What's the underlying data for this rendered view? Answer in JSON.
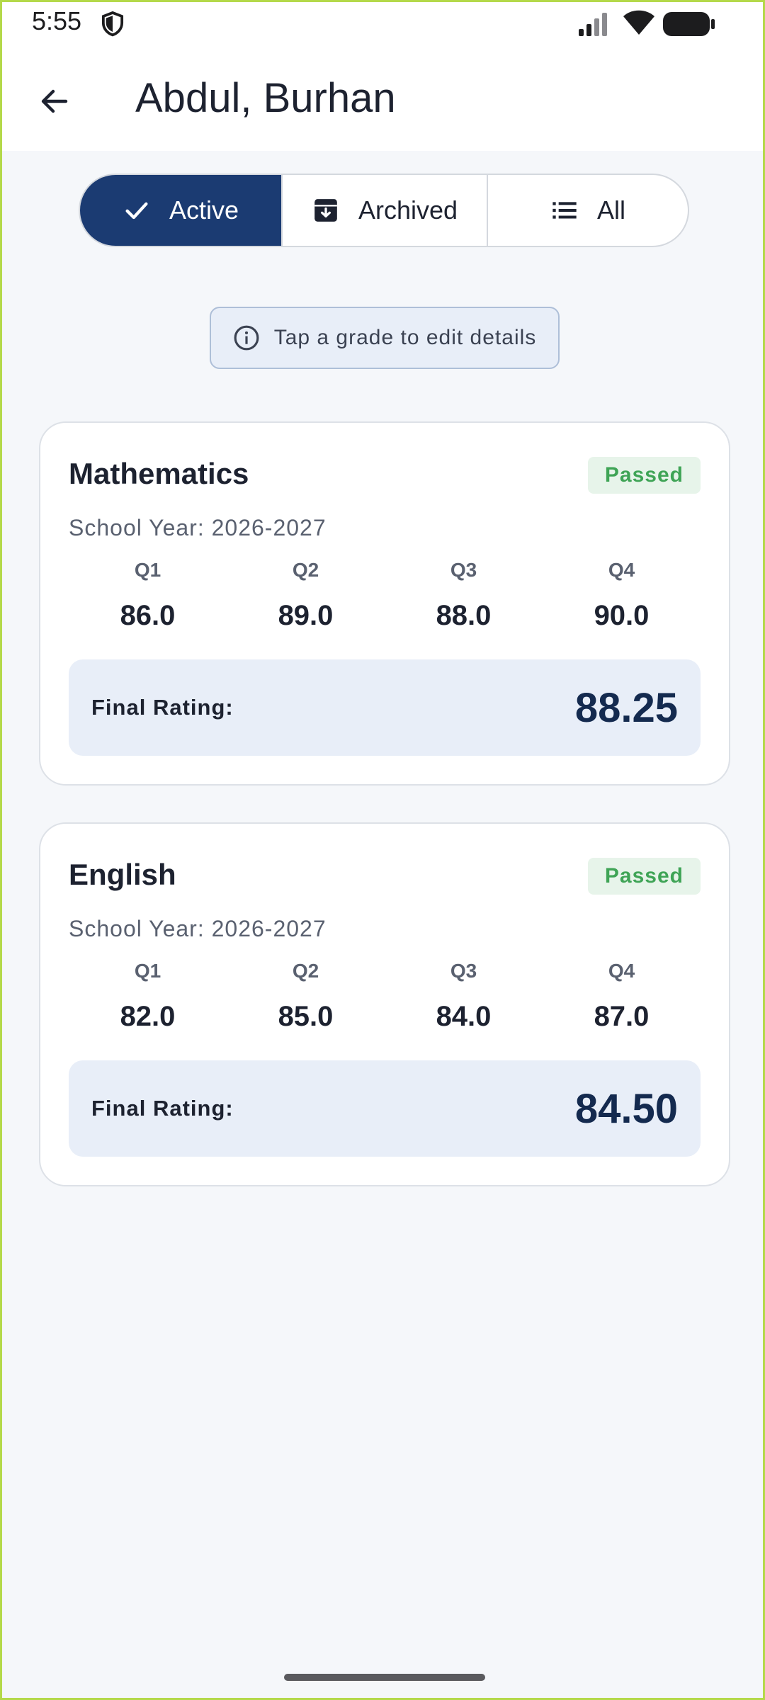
{
  "status_bar": {
    "time": "5:55",
    "icons": [
      "shield-icon",
      "signal-icon",
      "wifi-icon",
      "battery-icon"
    ]
  },
  "app_bar": {
    "title": "Abdul, Burhan",
    "back_icon": "arrow-left-icon"
  },
  "filter": {
    "selected": "Active",
    "segments": [
      {
        "label": "Active",
        "icon": "check-icon"
      },
      {
        "label": "Archived",
        "icon": "archive-box-icon"
      },
      {
        "label": "All",
        "icon": "list-icon"
      }
    ]
  },
  "hint": {
    "text": "Tap a grade to edit details",
    "icon": "info-icon"
  },
  "grades": [
    {
      "subject": "Mathematics",
      "status": "Passed",
      "school_year": "School Year: 2026-2027",
      "quarters": [
        {
          "label": "Q1",
          "value": "86.0"
        },
        {
          "label": "Q2",
          "value": "89.0"
        },
        {
          "label": "Q3",
          "value": "88.0"
        },
        {
          "label": "Q4",
          "value": "90.0"
        }
      ],
      "final_label": "Final Rating:",
      "final_value": "88.25"
    },
    {
      "subject": "English",
      "status": "Passed",
      "school_year": "School Year: 2026-2027",
      "quarters": [
        {
          "label": "Q1",
          "value": "82.0"
        },
        {
          "label": "Q2",
          "value": "85.0"
        },
        {
          "label": "Q3",
          "value": "84.0"
        },
        {
          "label": "Q4",
          "value": "87.0"
        }
      ],
      "final_label": "Final Rating:",
      "final_value": "84.50"
    }
  ],
  "colors": {
    "primary": "#1b3b72",
    "passed_text": "#3fa456",
    "passed_bg": "#e7f4ea",
    "background": "#f5f7fa"
  }
}
